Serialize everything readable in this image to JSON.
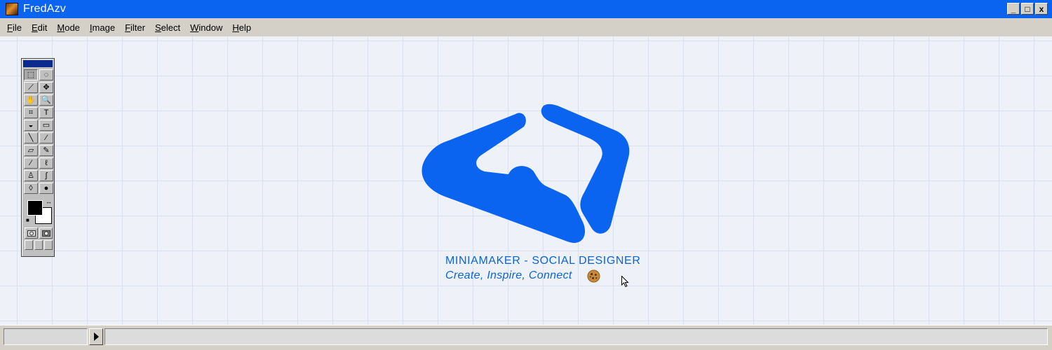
{
  "window": {
    "title": "FredAzv",
    "icon": "app-icon",
    "controls": {
      "minimize": "_",
      "maximize": "□",
      "close": "x"
    }
  },
  "menu": [
    {
      "label": "File",
      "accel": "F",
      "rest": "ile"
    },
    {
      "label": "Edit",
      "accel": "E",
      "rest": "dit"
    },
    {
      "label": "Mode",
      "accel": "M",
      "rest": "ode"
    },
    {
      "label": "Image",
      "accel": "I",
      "rest": "mage"
    },
    {
      "label": "Filter",
      "accel": "F",
      "rest": "ilter"
    },
    {
      "label": "Select",
      "accel": "S",
      "rest": "elect"
    },
    {
      "label": "Window",
      "accel": "W",
      "rest": "indow"
    },
    {
      "label": "Help",
      "accel": "H",
      "rest": "elp"
    }
  ],
  "toolbox": {
    "tools": [
      {
        "name": "marquee-icon",
        "glyph": "⬚",
        "active": true
      },
      {
        "name": "lasso-icon",
        "glyph": "◌"
      },
      {
        "name": "magic-wand-icon",
        "glyph": "⟋"
      },
      {
        "name": "move-icon",
        "glyph": "✥"
      },
      {
        "name": "hand-icon",
        "glyph": "✋"
      },
      {
        "name": "zoom-icon",
        "glyph": "🔍"
      },
      {
        "name": "crop-icon",
        "glyph": "⌗"
      },
      {
        "name": "type-icon",
        "glyph": "T"
      },
      {
        "name": "paint-bucket-icon",
        "glyph": "◒"
      },
      {
        "name": "gradient-icon",
        "glyph": "▭"
      },
      {
        "name": "line-icon",
        "glyph": "╲"
      },
      {
        "name": "eyedropper-icon",
        "glyph": "⁄"
      },
      {
        "name": "eraser-icon",
        "glyph": "▱"
      },
      {
        "name": "pencil-icon",
        "glyph": "✎"
      },
      {
        "name": "airbrush-icon",
        "glyph": "⁄"
      },
      {
        "name": "brush-icon",
        "glyph": "ℓ"
      },
      {
        "name": "stamp-icon",
        "glyph": "♙"
      },
      {
        "name": "smudge-icon",
        "glyph": "ʃ"
      },
      {
        "name": "blur-icon",
        "glyph": "◊"
      },
      {
        "name": "dodge-icon",
        "glyph": "●"
      }
    ],
    "foreground_color": "#000000",
    "background_color": "#ffffff"
  },
  "logo": {
    "name": "MINIAMAKER - SOCIAL DESIGNER",
    "tagline": "Create, Inspire, Connect",
    "color": "#0a64f0",
    "emoji": "cookie-icon"
  },
  "colors": {
    "titlebar": "#0a64f0",
    "chrome": "#d4d0c8",
    "canvas": "#eef2f8",
    "accent": "#0a64f0"
  }
}
